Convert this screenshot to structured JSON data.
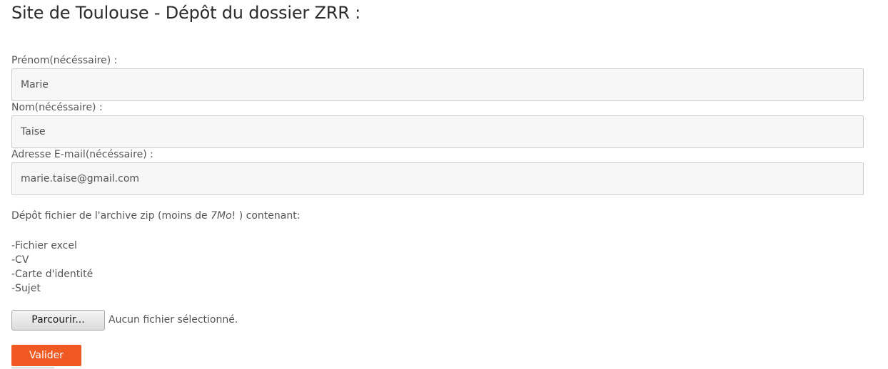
{
  "page": {
    "title": "Site de Toulouse - Dépôt du dossier ZRR :"
  },
  "form": {
    "firstname": {
      "label": "Prénom(nécéssaire) :",
      "value": "Marie"
    },
    "lastname": {
      "label": "Nom(nécéssaire) :",
      "value": "Taise"
    },
    "email": {
      "label": "Adresse E-mail(nécéssaire) :",
      "value": "marie.taise@gmail.com"
    },
    "upload": {
      "instructions_before": "Dépôt fichier de l'archive zip (moins de ",
      "instructions_size": "7Mo",
      "instructions_after": "! ) contenant:",
      "required_files": [
        "-Fichier excel",
        "-CV",
        "-Carte d'identité",
        "-Sujet"
      ],
      "browse_label": "Parcourir...",
      "status": "Aucun fichier sélectionné."
    },
    "submit_label": "Valider"
  },
  "colors": {
    "accent": "#f05a22",
    "input_background": "#f6f6f6",
    "input_border": "#cccccc"
  }
}
